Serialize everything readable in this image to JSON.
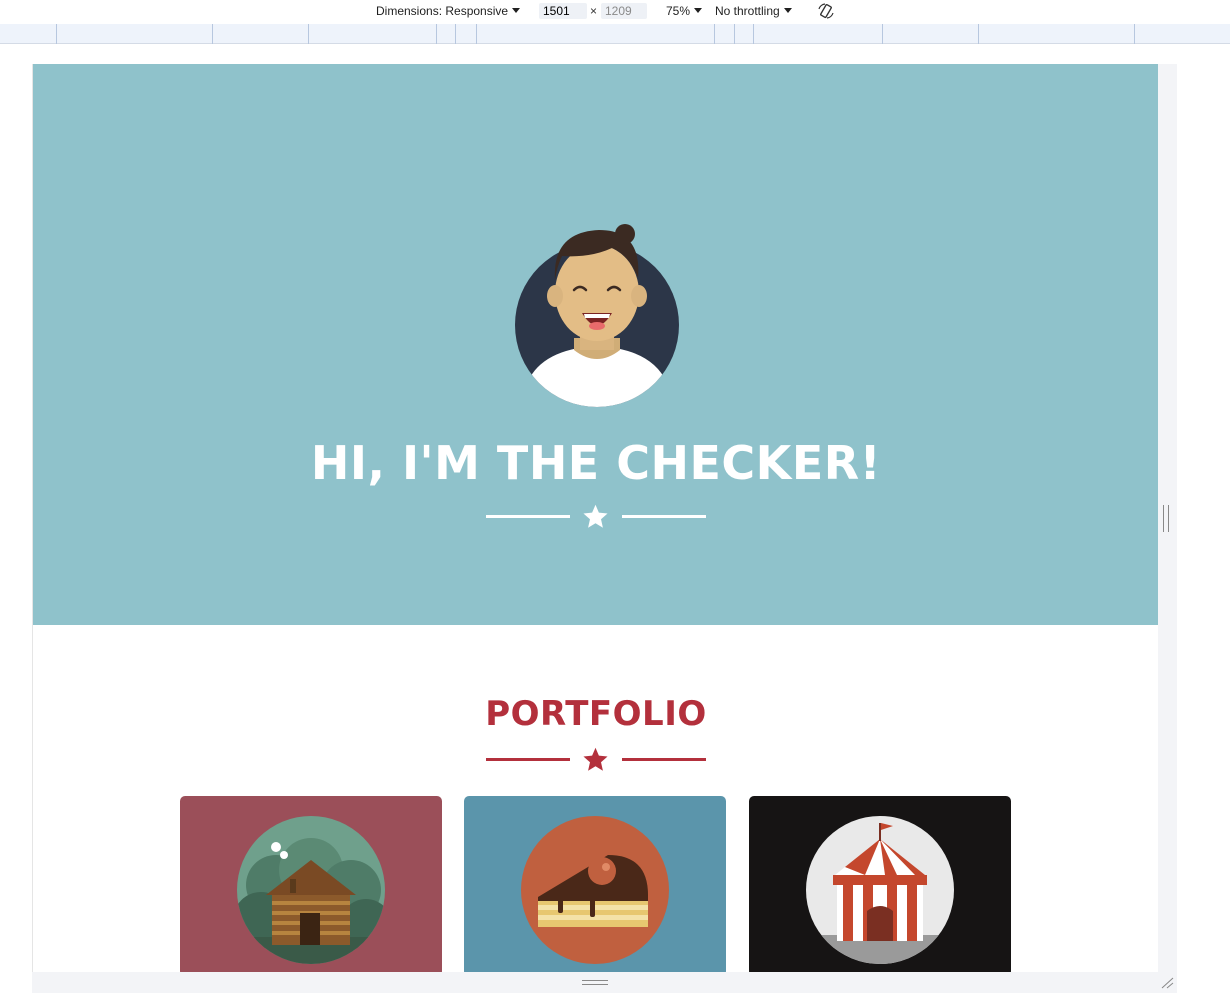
{
  "devtools": {
    "dimensions_label": "Dimensions: Responsive",
    "width_value": "1501",
    "times": "×",
    "height_value": "1209",
    "zoom": "75%",
    "throttling": "No throttling",
    "rotate_icon": "rotate-icon"
  },
  "site": {
    "hero_title": "HI, I'M THE CHECKER!",
    "portfolio_title": "PORTFOLIO",
    "portfolio_items": [
      {
        "name": "cabin",
        "bg": "#9b4f59"
      },
      {
        "name": "cake",
        "bg": "#5b95ab"
      },
      {
        "name": "circus",
        "bg": "#161414"
      }
    ]
  },
  "colors": {
    "masthead": "#8fc2cb",
    "accent": "#b3303c",
    "white": "#ffffff"
  }
}
